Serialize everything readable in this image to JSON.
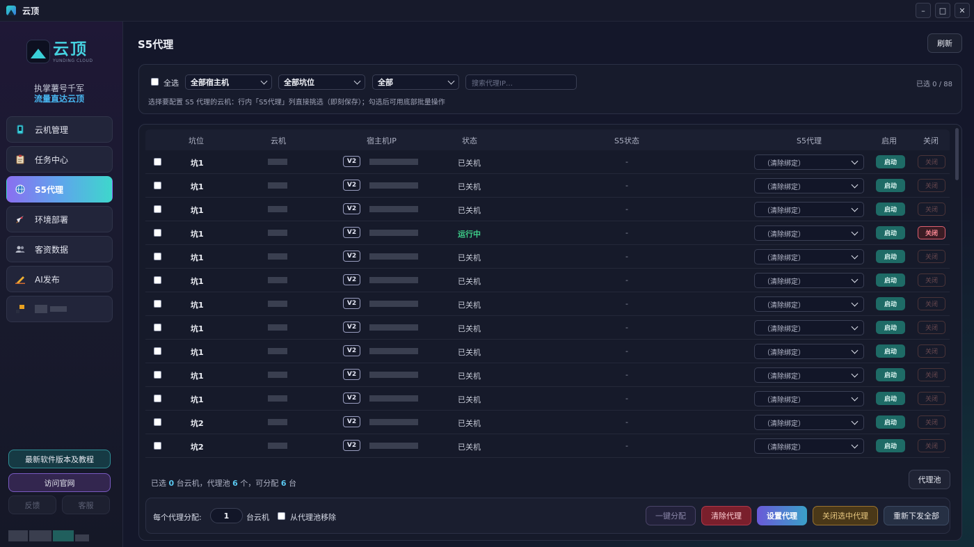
{
  "window": {
    "title": "云顶",
    "min": "–",
    "max": "□",
    "close": "✕"
  },
  "brand": {
    "name": "云顶",
    "sub": "YUNDING CLOUD",
    "slogan1": "执掌薯号千军",
    "slogan2": "流量直达云顶"
  },
  "nav": [
    {
      "label": "云机管理",
      "icon": "phone-icon"
    },
    {
      "label": "任务中心",
      "icon": "clipboard-icon"
    },
    {
      "label": "S5代理",
      "icon": "globe-icon"
    },
    {
      "label": "环境部署",
      "icon": "rocket-icon"
    },
    {
      "label": "客资数据",
      "icon": "users-icon"
    },
    {
      "label": "AI发布",
      "icon": "pen-icon"
    }
  ],
  "sidebar_buttons": {
    "latest": "最新软件版本及教程",
    "official": "访问官网",
    "feedback": "反馈",
    "service": "客服"
  },
  "page": {
    "title": "S5代理",
    "refresh": "刷新"
  },
  "filter": {
    "select_all": "全选",
    "host": "全部宿主机",
    "slot": "全部坑位",
    "all": "全部",
    "search_placeholder": "搜索代理IP…",
    "selected_count": "已选 0 / 88",
    "hint": "选择要配置 S5 代理的云机：行内「S5代理」列直接挑选（即刻保存）；勾选后可用底部批量操作"
  },
  "table": {
    "headers": [
      "坑位",
      "云机",
      "宿主机IP",
      "状态",
      "S5状态",
      "S5代理",
      "启用",
      "关闭"
    ],
    "rows": [
      {
        "slot": "坑1",
        "tag": "V2",
        "status": "已关机",
        "s5": "-",
        "proxy": "（清除绑定）",
        "start": "启动",
        "close": "关闭",
        "running": false
      },
      {
        "slot": "坑1",
        "tag": "V2",
        "status": "已关机",
        "s5": "-",
        "proxy": "（清除绑定）",
        "start": "启动",
        "close": "关闭",
        "running": false
      },
      {
        "slot": "坑1",
        "tag": "V2",
        "status": "已关机",
        "s5": "-",
        "proxy": "（清除绑定）",
        "start": "启动",
        "close": "关闭",
        "running": false
      },
      {
        "slot": "坑1",
        "tag": "V2",
        "status": "运行中",
        "s5": "-",
        "proxy": "（清除绑定）",
        "start": "启动",
        "close": "关闭",
        "running": true
      },
      {
        "slot": "坑1",
        "tag": "V2",
        "status": "已关机",
        "s5": "-",
        "proxy": "（清除绑定）",
        "start": "启动",
        "close": "关闭",
        "running": false
      },
      {
        "slot": "坑1",
        "tag": "V2",
        "status": "已关机",
        "s5": "-",
        "proxy": "（清除绑定）",
        "start": "启动",
        "close": "关闭",
        "running": false
      },
      {
        "slot": "坑1",
        "tag": "V2",
        "status": "已关机",
        "s5": "-",
        "proxy": "（清除绑定）",
        "start": "启动",
        "close": "关闭",
        "running": false
      },
      {
        "slot": "坑1",
        "tag": "V2",
        "status": "已关机",
        "s5": "-",
        "proxy": "（清除绑定）",
        "start": "启动",
        "close": "关闭",
        "running": false
      },
      {
        "slot": "坑1",
        "tag": "V2",
        "status": "已关机",
        "s5": "-",
        "proxy": "（清除绑定）",
        "start": "启动",
        "close": "关闭",
        "running": false
      },
      {
        "slot": "坑1",
        "tag": "V2",
        "status": "已关机",
        "s5": "-",
        "proxy": "（清除绑定）",
        "start": "启动",
        "close": "关闭",
        "running": false
      },
      {
        "slot": "坑1",
        "tag": "V2",
        "status": "已关机",
        "s5": "-",
        "proxy": "（清除绑定）",
        "start": "启动",
        "close": "关闭",
        "running": false
      },
      {
        "slot": "坑2",
        "tag": "V2",
        "status": "已关机",
        "s5": "-",
        "proxy": "（清除绑定）",
        "start": "启动",
        "close": "关闭",
        "running": false
      },
      {
        "slot": "坑2",
        "tag": "V2",
        "status": "已关机",
        "s5": "-",
        "proxy": "（清除绑定）",
        "start": "启动",
        "close": "关闭",
        "running": false
      }
    ]
  },
  "summary": {
    "p1": "已选 ",
    "selected": "0",
    "p2": " 台云机，代理池 ",
    "pool": "6",
    "p3": " 个，可分配 ",
    "alloc": "6",
    "p4": " 台"
  },
  "pool_button": "代理池",
  "bottom": {
    "per_proxy_label": "每个代理分配:",
    "per_proxy_value": "1",
    "unit": "台云机",
    "remove_label": "从代理池移除",
    "btn_auto": "一键分配",
    "btn_clear": "清除代理",
    "btn_set": "设置代理",
    "btn_close_sel": "关闭选中代理",
    "btn_redeploy": "重新下发全部"
  },
  "colors": {
    "accent_teal": "#3ed7cc",
    "accent_purple": "#8a6ff0",
    "running": "#3ed08a",
    "danger": "#e06070"
  }
}
